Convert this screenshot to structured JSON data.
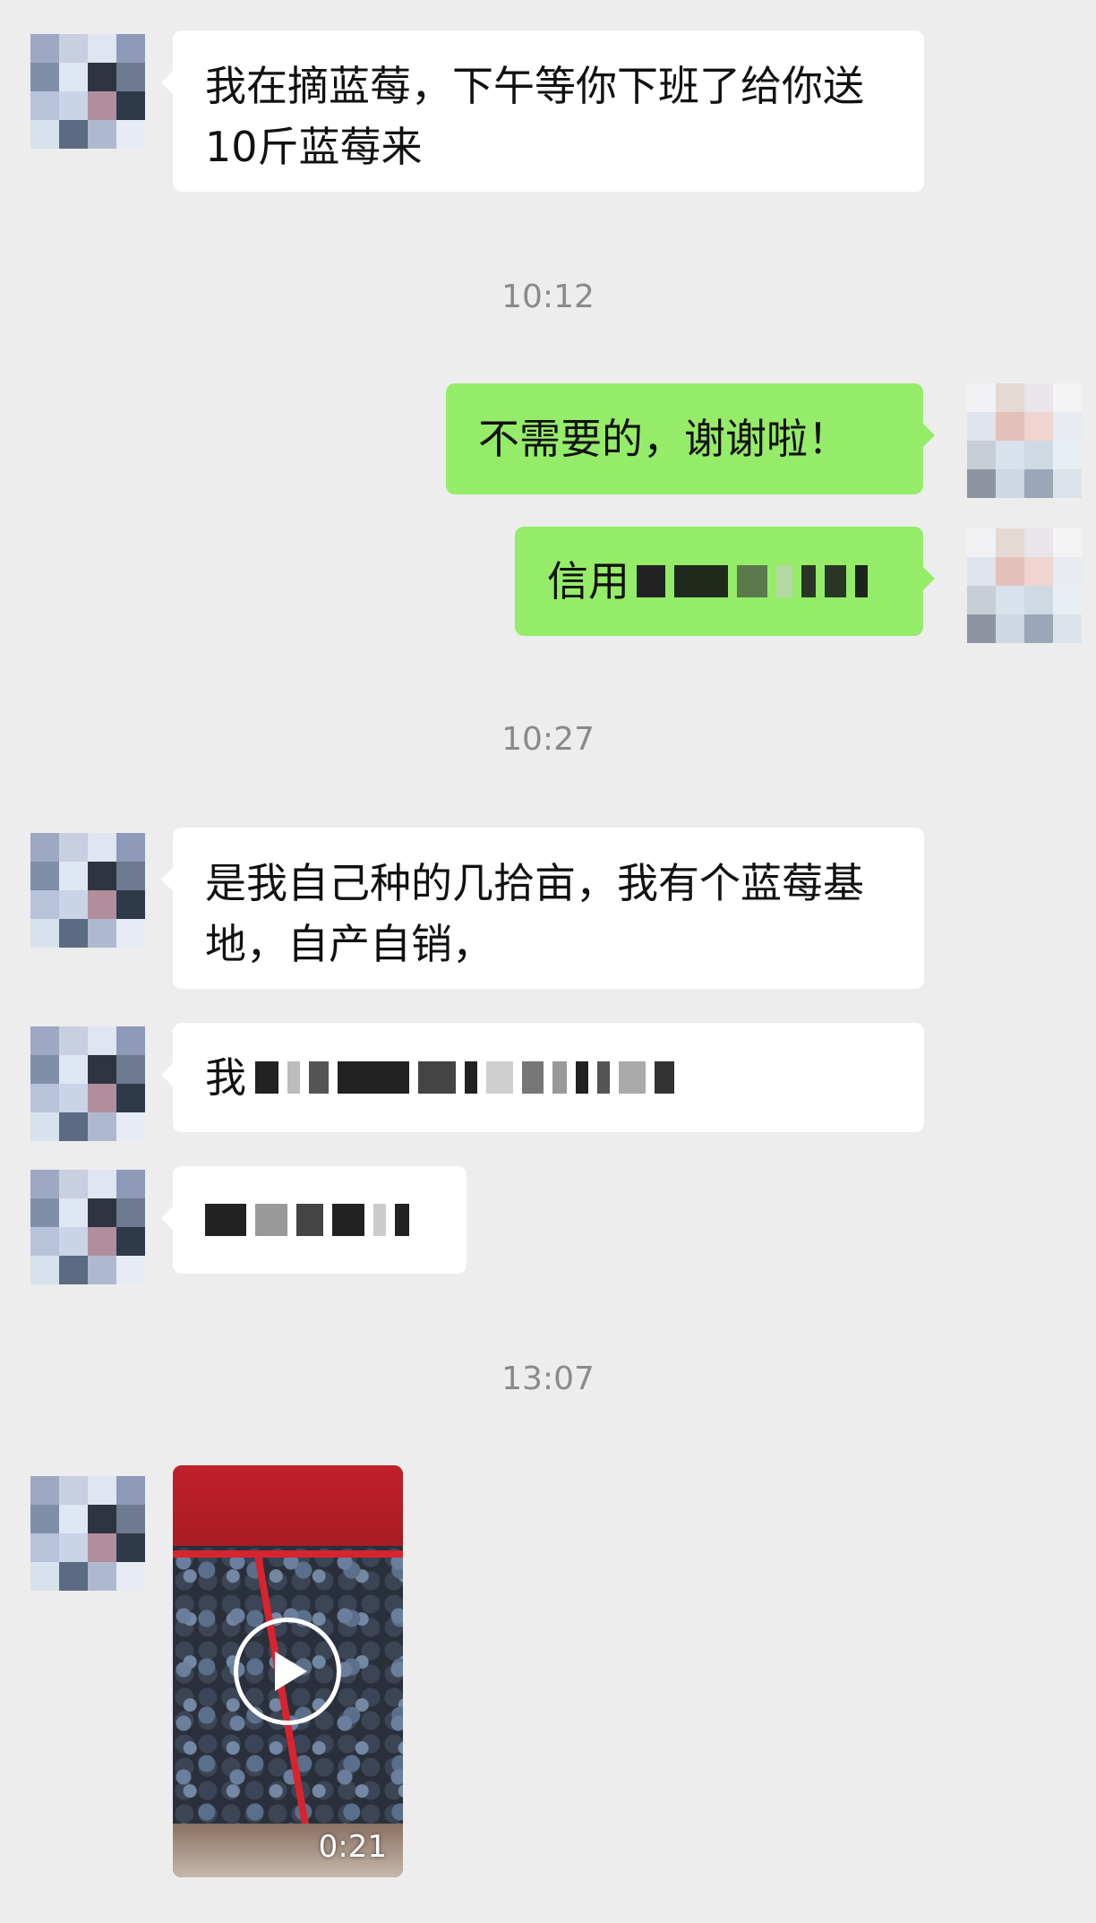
{
  "chat": {
    "messages": [
      {
        "id": "m1",
        "text": "我在摘蓝莓，下午等你下班了给你送10斤蓝莓来"
      },
      {
        "id": "m2",
        "text": "不需要的，谢谢啦！"
      },
      {
        "id": "m3",
        "text": "信用"
      },
      {
        "id": "m4",
        "text": "是我自己种的几拾亩，我有个蓝莓基地，自产自销，"
      },
      {
        "id": "m5",
        "text": "我"
      },
      {
        "id": "m6",
        "text": ""
      }
    ],
    "timestamps": [
      "10:12",
      "10:27",
      "13:07"
    ],
    "video": {
      "duration": "0:21"
    }
  },
  "colors": {
    "background": "#ededed",
    "incoming_bubble": "#ffffff",
    "outgoing_bubble": "#95ec69",
    "timestamp_text": "#8a8a8a"
  },
  "icons": {
    "play": "play-icon"
  }
}
